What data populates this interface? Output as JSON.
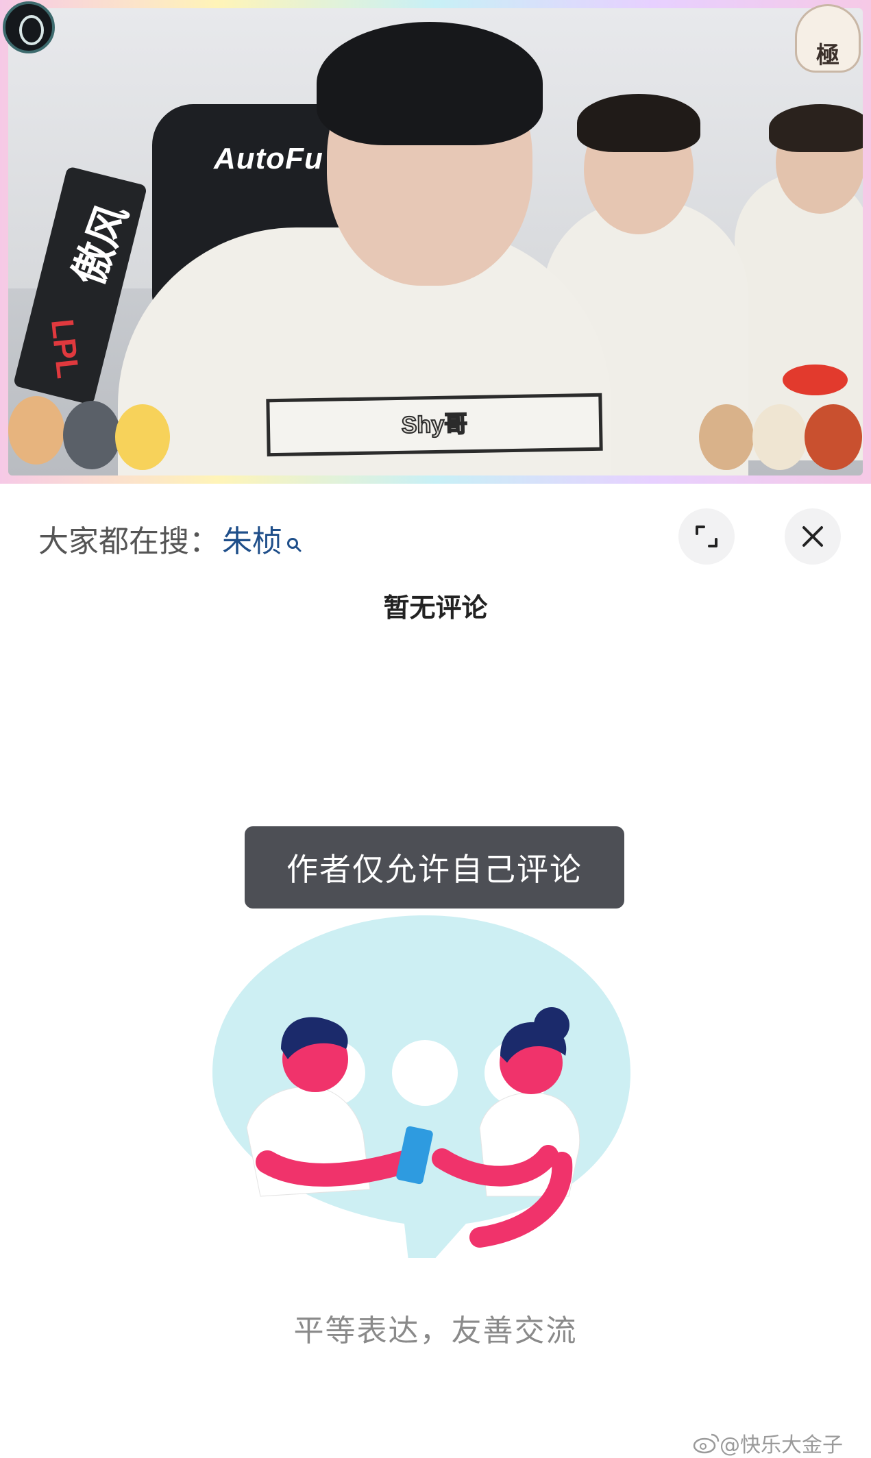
{
  "video": {
    "chair_brand": "AutoFu",
    "banner_text": "傲风",
    "banner_sub": "LPL",
    "ghost_badge_text": "極",
    "name_tag": "Shy哥"
  },
  "sheet": {
    "hot_search_label": "大家都在搜：",
    "hot_search_keyword": "朱桢",
    "no_comments": "暂无评论",
    "toast": "作者仅允许自己评论",
    "slogan": "平等表达，友善交流",
    "watermark": "@快乐大金子"
  },
  "colors": {
    "keyword": "#1f4f8a",
    "toast_bg": "#4d4f55",
    "bubble": "#cdeff3",
    "figure_pink": "#f0336b"
  }
}
